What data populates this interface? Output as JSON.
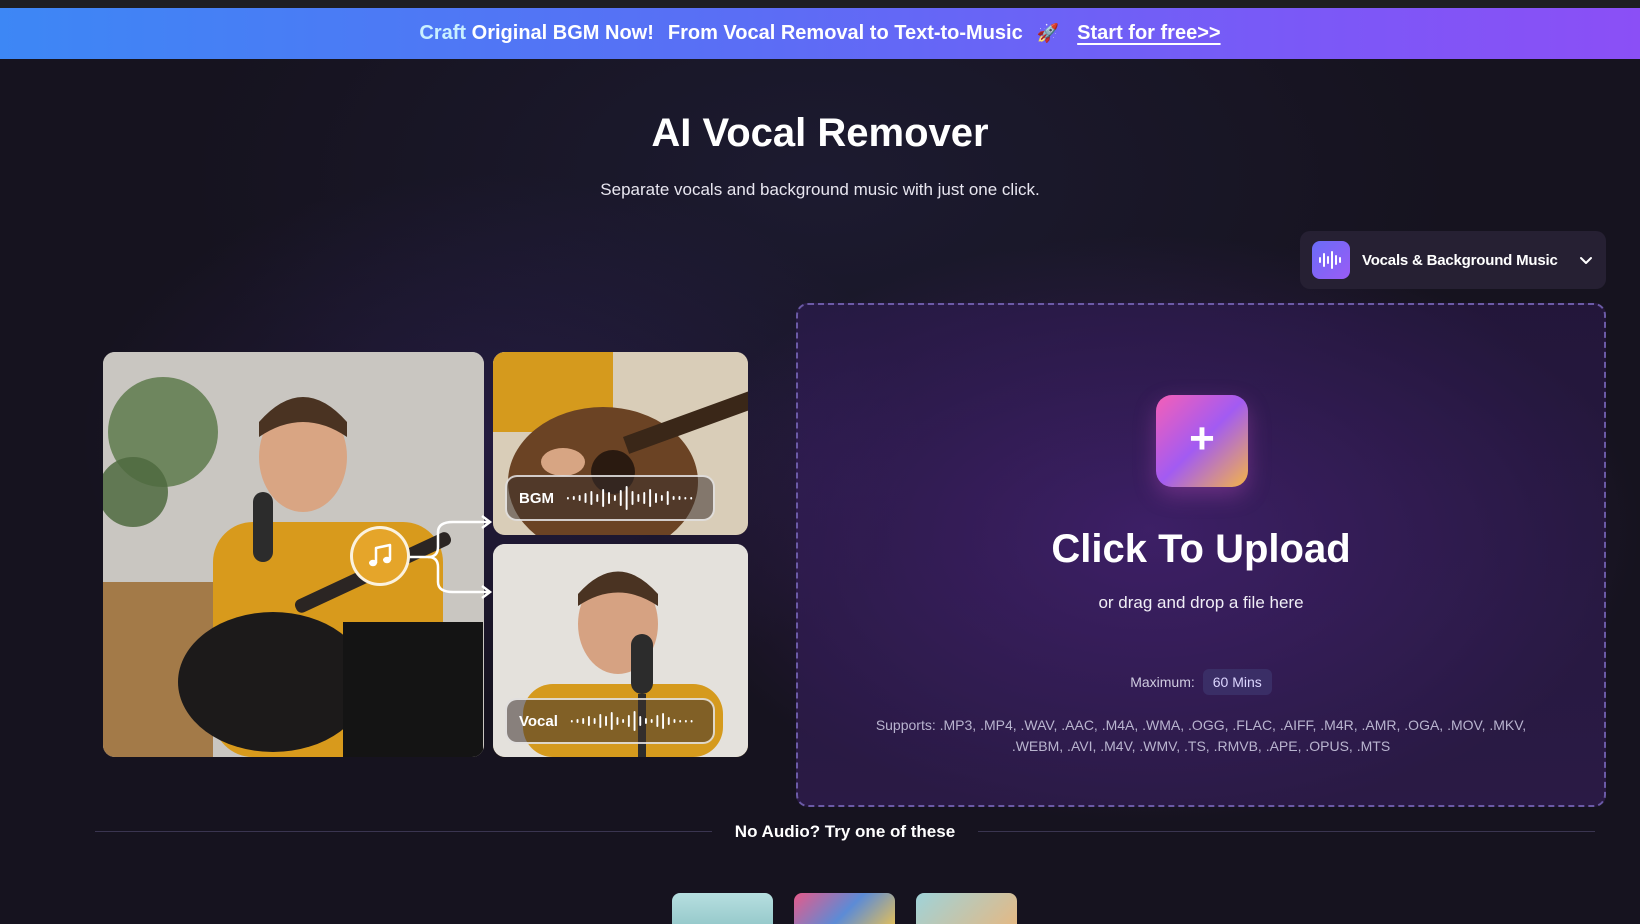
{
  "banner": {
    "craft": "Craft",
    "original": "Original BGM Now!",
    "message": "From Vocal Removal to Text-to-Music",
    "rocket": "🚀",
    "cta": "Start for free>>"
  },
  "hero": {
    "title": "AI Vocal Remover",
    "subtitle": "Separate vocals and background music with just one click."
  },
  "mode_selector": {
    "label": "Vocals & Background Music",
    "icon": "waveform-icon"
  },
  "illustration": {
    "bgm_label": "BGM",
    "vocal_label": "Vocal",
    "icon": "music-note-icon"
  },
  "upload": {
    "title": "Click To Upload",
    "subtitle": "or drag and drop a file here",
    "max_label": "Maximum:",
    "max_value": "60 Mins",
    "supports": "Supports: .MP3, .MP4, .WAV, .AAC, .M4A, .WMA, .OGG, .FLAC, .AIFF, .M4R, .AMR, .OGA, .MOV, .MKV, .WEBM, .AVI, .M4V, .WMV, .TS, .RMVB, .APE, .OPUS, .MTS"
  },
  "samples": {
    "heading": "No Audio? Try one of these"
  },
  "colors": {
    "banner_start": "#3d87f5",
    "banner_end": "#8b4ff6",
    "background": "#16131f",
    "dropzone_border": "#6b5aa6",
    "upload_gradient_pink": "#f55fb7",
    "upload_gradient_gold": "#f4b447"
  }
}
